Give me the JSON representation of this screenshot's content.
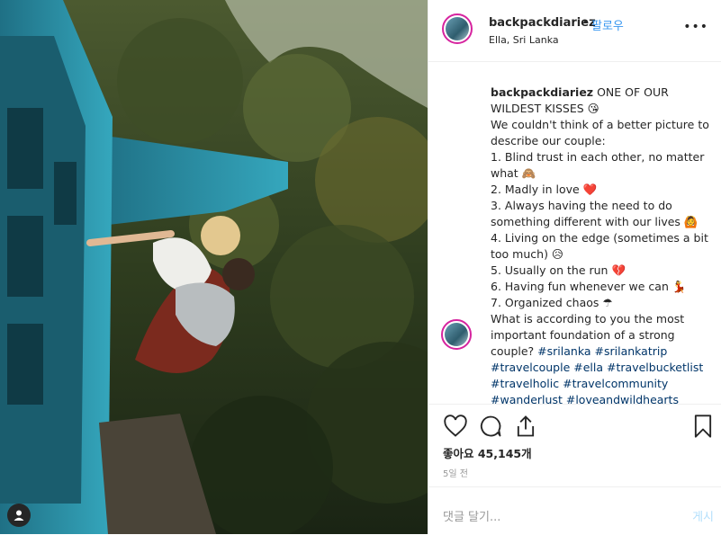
{
  "header": {
    "username": "backpackdiariez",
    "dot": "•",
    "follow_label": "팔로우",
    "location": "Ella, Sri Lanka",
    "more_icon": "more-icon"
  },
  "caption": {
    "username": "backpackdiariez",
    "lines": [
      "ONE OF OUR WILDEST KISSES 😘",
      "We couldn't think of a better picture to describe our couple:",
      "1. Blind trust in each other, no matter what 🙈",
      "2. Madly in love ❤️",
      "3. Always having the need to do something different with our lives 🙆",
      "4. Living on the edge (sometimes a bit too much) 😥",
      "5. Usually on the run 💔",
      "6. Having fun whenever we can 💃",
      "7. Organized chaos ☂",
      "What is according to you the most important foundation of a strong couple?"
    ],
    "hashtags": [
      "#srilanka",
      "#srilankatrip",
      "#travelcouple",
      "#ella",
      "#travelbucketlist",
      "#travelholic",
      "#travelcommunity",
      "#wanderlust",
      "#loveandwildhearts"
    ]
  },
  "actions": {
    "like_icon": "heart-icon",
    "comment_icon": "comment-icon",
    "share_icon": "share-icon",
    "save_icon": "bookmark-icon"
  },
  "likes_label": "좋아요 45,145개",
  "time_label": "5일 전",
  "comment": {
    "placeholder": "댓글 달기...",
    "post_label": "게시"
  },
  "colors": {
    "link": "#3897f0",
    "hashtag": "#003569",
    "train": "#2a8fa6",
    "story_ring": "#d6249f"
  }
}
